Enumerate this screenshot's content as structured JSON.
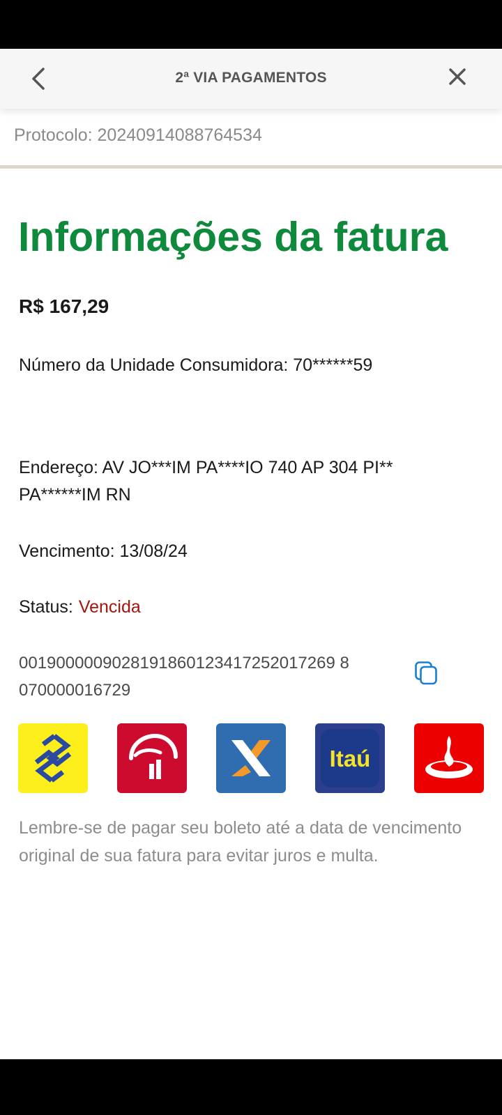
{
  "header": {
    "title": "2ª VIA PAGAMENTOS",
    "back_icon": "chevron-left-icon",
    "close_icon": "close-icon"
  },
  "protocol": "Protocolo: 20240914088764534",
  "invoice": {
    "title": "Informações da fatura",
    "amount": "R$ 167,29",
    "unit_number": "Número da Unidade Consumidora: 70******59",
    "address_line1": "Endereço: AV JO***IM PA****IO 740 AP 304 PI**",
    "address_line2": "PA******IM RN",
    "due_date": "Vencimento: 13/08/24",
    "status_label": "Status:",
    "status_value": "Vencida",
    "barcode_line1": "0019000009028191860123417252017269 8",
    "barcode_line2": "070000016729",
    "copy_icon": "copy-icon"
  },
  "banks": [
    {
      "name": "Banco do Brasil",
      "icon": "banco-do-brasil-logo",
      "color": "#fcef1c"
    },
    {
      "name": "Bradesco",
      "icon": "bradesco-logo",
      "color": "#cc0b2e"
    },
    {
      "name": "Caixa",
      "icon": "caixa-logo",
      "color": "#2f6db0"
    },
    {
      "name": "Itaú",
      "label": "Itaú",
      "icon": "itau-logo",
      "color": "#2b3f8c"
    },
    {
      "name": "Santander",
      "icon": "santander-logo",
      "color": "#ec0000"
    }
  ],
  "reminder": "Lembre-se de pagar seu boleto até a data de vencimento original de sua fatura para evitar juros e multa.",
  "colors": {
    "title_green": "#0f8a3c",
    "status_red": "#a3160f",
    "copy_blue": "#1a7fd0"
  }
}
